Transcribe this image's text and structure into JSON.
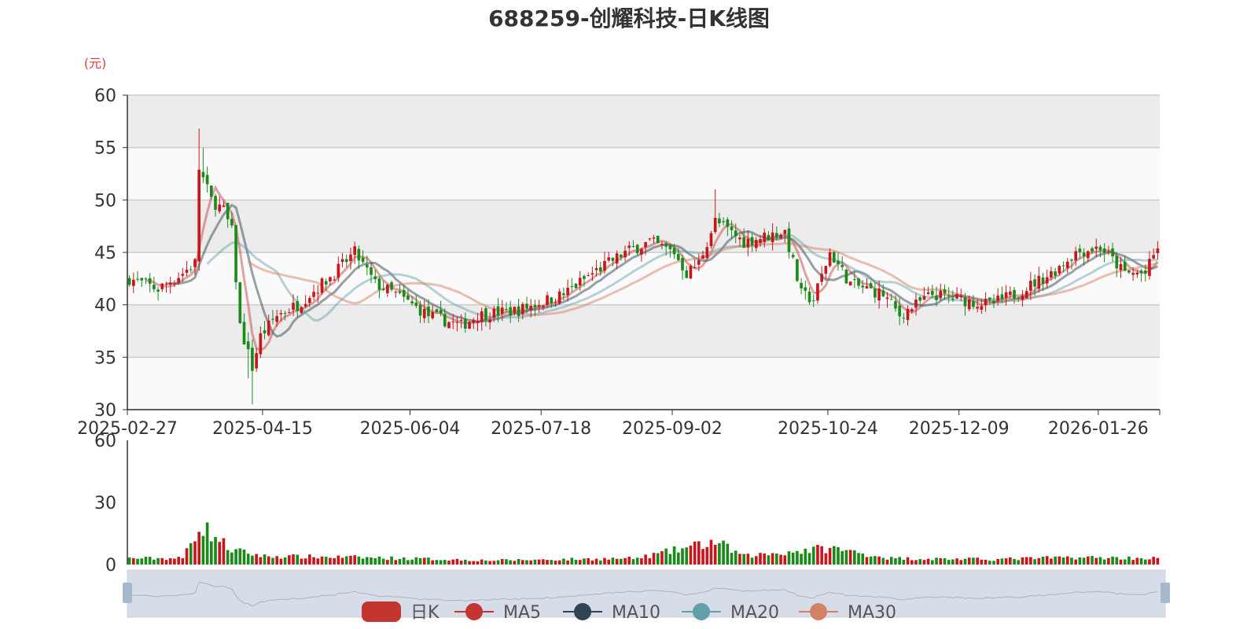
{
  "chart_data": {
    "type": "candlestick",
    "title": "688259-创耀科技-日K线图",
    "ylabel": "(元)",
    "ylim": [
      30,
      60
    ],
    "yticks": [
      30,
      35,
      40,
      45,
      50,
      55,
      60
    ],
    "xticks": [
      "2025-02-27",
      "2025-04-15",
      "2025-06-04",
      "2025-07-18",
      "2025-09-02",
      "2025-10-24",
      "2025-12-09",
      "2026-01-26"
    ],
    "volume_ylim": [
      0,
      60
    ],
    "volume_yticks": [
      0,
      30,
      60
    ],
    "grid": true,
    "legend_position": "bottom",
    "legend": [
      {
        "name": "日K",
        "color": "#c23531"
      },
      {
        "name": "MA5",
        "color": "#c23531"
      },
      {
        "name": "MA10",
        "color": "#2f4554"
      },
      {
        "name": "MA20",
        "color": "#61a0a8"
      },
      {
        "name": "MA30",
        "color": "#d48265"
      }
    ],
    "up_color": "#c8161d",
    "down_color": "#1b8a1b",
    "close_anchors": [
      [
        "2025-02-27",
        42.5
      ],
      [
        "2025-03-10",
        41.5
      ],
      [
        "2025-03-18",
        43
      ],
      [
        "2025-03-21",
        44
      ],
      [
        "2025-03-24",
        53
      ],
      [
        "2025-03-27",
        50
      ],
      [
        "2025-04-01",
        49
      ],
      [
        "2025-04-03",
        47
      ],
      [
        "2025-04-07",
        38
      ],
      [
        "2025-04-10",
        34
      ],
      [
        "2025-04-14",
        37
      ],
      [
        "2025-04-18",
        39
      ],
      [
        "2025-04-25",
        40
      ],
      [
        "2025-05-08",
        43
      ],
      [
        "2025-05-15",
        45
      ],
      [
        "2025-05-22",
        42
      ],
      [
        "2025-05-29",
        41
      ],
      [
        "2025-06-10",
        39
      ],
      [
        "2025-06-20",
        38
      ],
      [
        "2025-06-26",
        39
      ],
      [
        "2025-07-10",
        39.5
      ],
      [
        "2025-07-25",
        41
      ],
      [
        "2025-08-05",
        43
      ],
      [
        "2025-08-15",
        45
      ],
      [
        "2025-08-25",
        46
      ],
      [
        "2025-09-02",
        45
      ],
      [
        "2025-09-05",
        43
      ],
      [
        "2025-09-10",
        44
      ],
      [
        "2025-09-16",
        48
      ],
      [
        "2025-09-25",
        46
      ],
      [
        "2025-10-09",
        47
      ],
      [
        "2025-10-15",
        41
      ],
      [
        "2025-10-20",
        40.5
      ],
      [
        "2025-10-24",
        45
      ],
      [
        "2025-10-31",
        42
      ],
      [
        "2025-11-12",
        41
      ],
      [
        "2025-11-18",
        39
      ],
      [
        "2025-11-28",
        41
      ],
      [
        "2025-12-09",
        40.5
      ],
      [
        "2025-12-18",
        40
      ],
      [
        "2025-12-26",
        41
      ],
      [
        "2026-01-08",
        43
      ],
      [
        "2026-01-16",
        45
      ],
      [
        "2026-01-26",
        45.5
      ],
      [
        "2026-02-03",
        43
      ],
      [
        "2026-02-10",
        43
      ],
      [
        "2026-02-13",
        45.5
      ]
    ],
    "volume_anchors": [
      [
        "2025-02-27",
        3
      ],
      [
        "2025-03-18",
        3
      ],
      [
        "2025-03-24",
        19
      ],
      [
        "2025-03-27",
        15
      ],
      [
        "2025-04-03",
        7
      ],
      [
        "2025-04-15",
        4
      ],
      [
        "2025-05-15",
        3.5
      ],
      [
        "2025-07-01",
        2
      ],
      [
        "2025-08-20",
        3
      ],
      [
        "2025-09-16",
        11
      ],
      [
        "2025-09-25",
        4
      ],
      [
        "2025-10-24",
        8
      ],
      [
        "2025-11-15",
        3
      ],
      [
        "2025-12-20",
        2.5
      ],
      [
        "2026-01-15",
        3.5
      ],
      [
        "2026-02-13",
        3
      ]
    ]
  }
}
